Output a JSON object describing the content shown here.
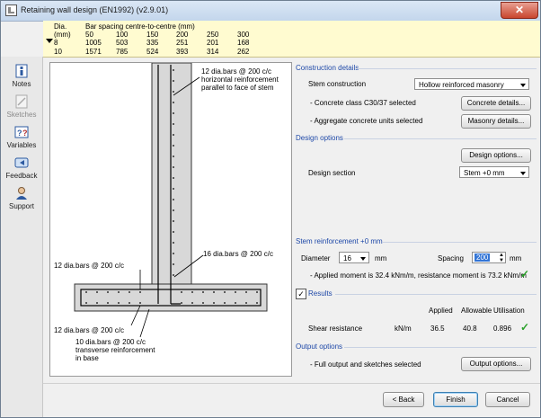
{
  "window": {
    "title": "Retaining wall design (EN1992) (v2.9.01)",
    "close_glyph": "✕"
  },
  "bar_table": {
    "col1_header": "Dia.",
    "col1_unit": "(mm)",
    "spacing_header": "Bar spacing centre-to-centre (mm)",
    "spacings": [
      "50",
      "100",
      "150",
      "200",
      "250",
      "300"
    ],
    "rows": [
      {
        "dia": "8",
        "values": [
          "1005",
          "503",
          "335",
          "251",
          "201",
          "168"
        ]
      },
      {
        "dia": "10",
        "values": [
          "1571",
          "785",
          "524",
          "393",
          "314",
          "262"
        ]
      }
    ]
  },
  "sidebar": {
    "items": [
      {
        "label": "Notes",
        "icon": "notes-icon",
        "enabled": true
      },
      {
        "label": "Sketches",
        "icon": "sketches-icon",
        "enabled": false
      },
      {
        "label": "Variables",
        "icon": "variables-icon",
        "enabled": true
      },
      {
        "label": "Feedback",
        "icon": "feedback-icon",
        "enabled": true
      },
      {
        "label": "Support",
        "icon": "support-icon",
        "enabled": true
      }
    ]
  },
  "diagram": {
    "label_top_line1": "12 dia.bars @ 200 c/c",
    "label_top_line2": "horizontal reinforcement",
    "label_top_line3": "parallel to face of stem",
    "label_stem": "16 dia.bars @ 200 c/c",
    "label_base_top": "12 dia.bars @ 200 c/c",
    "label_base_bottom": "12 dia.bars @ 200 c/c",
    "label_transverse_line1": "10 dia.bars @ 200 c/c",
    "label_transverse_line2": "transverse reinforcement",
    "label_transverse_line3": "in base"
  },
  "construction": {
    "section_title": "Construction details",
    "stem_construction_label": "Stem construction",
    "stem_construction_value": "Hollow reinforced masonry",
    "concrete_text": "- Concrete class C30/37 selected",
    "concrete_button": "Concrete details...",
    "aggregate_text": "- Aggregate concrete units selected",
    "masonry_button": "Masonry details..."
  },
  "design": {
    "section_title": "Design options",
    "options_button": "Design options...",
    "section_label": "Design section",
    "section_value": "Stem +0 mm"
  },
  "stem_reinf": {
    "section_title": "Stem reinforcement +0 mm",
    "diameter_label": "Diameter",
    "diameter_value": "16",
    "diameter_unit": "mm",
    "spacing_label": "Spacing",
    "spacing_value": "200",
    "spacing_unit": "mm",
    "moment_text": "- Applied moment is 32.4 kNm/m, resistance moment is 73.2 kNm/m"
  },
  "results": {
    "title": "Results",
    "checked": true,
    "col_applied": "Applied",
    "col_allowable": "Allowable",
    "col_utilisation": "Utilisation",
    "row_label": "Shear resistance",
    "row_unit": "kN/m",
    "row_applied": "36.5",
    "row_allowable": "40.8",
    "row_utilisation": "0.896"
  },
  "output": {
    "section_title": "Output options",
    "text": "- Full output and sketches selected",
    "button": "Output options..."
  },
  "footer": {
    "back": "< Back",
    "finish": "Finish",
    "cancel": "Cancel"
  },
  "colors": {
    "section_title": "#1f49a8",
    "ok_check": "#2aa12a",
    "table_bg": "#fffbd0"
  }
}
